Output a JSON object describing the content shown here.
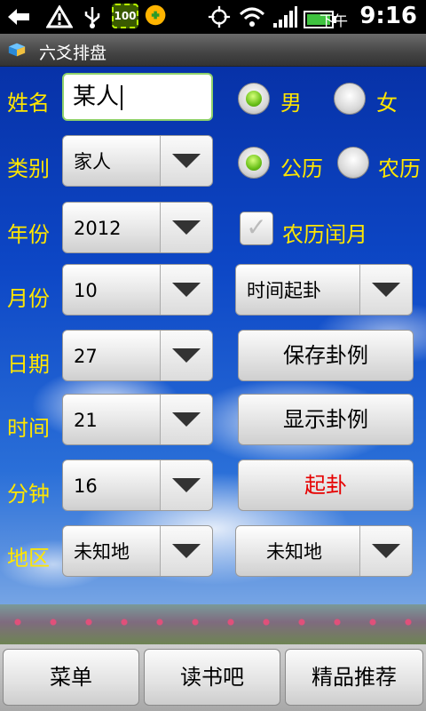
{
  "status": {
    "ampm": "下午",
    "time": "9:16",
    "battery_badge": "100",
    "icons": [
      "back-icon",
      "warning-icon",
      "usb-icon",
      "battery-saver-icon",
      "app-icon",
      "gps-icon",
      "wifi-icon",
      "signal-icon",
      "battery-icon"
    ]
  },
  "app": {
    "title": "六爻排盘"
  },
  "form": {
    "name_label": "姓名",
    "name_value": "某人",
    "gender_male": "男",
    "gender_female": "女",
    "category_label": "类别",
    "category_value": "家人",
    "calendar_solar": "公历",
    "calendar_lunar": "农历",
    "year_label": "年份",
    "year_value": "2012",
    "leap_month_label": "农历闰月",
    "month_label": "月份",
    "month_value": "10",
    "method_value": "时间起卦",
    "day_label": "日期",
    "day_value": "27",
    "save_button": "保存卦例",
    "hour_label": "时间",
    "hour_value": "21",
    "show_button": "显示卦例",
    "minute_label": "分钟",
    "minute_value": "16",
    "start_button": "起卦",
    "region_label": "地区",
    "region_value": "未知地",
    "region2_value": "未知地"
  },
  "bottom": {
    "menu": "菜单",
    "read": "读书吧",
    "featured": "精品推荐"
  },
  "colors": {
    "label_yellow": "#ffe600",
    "start_red": "#e60000",
    "radio_green": "#6bc11a"
  }
}
